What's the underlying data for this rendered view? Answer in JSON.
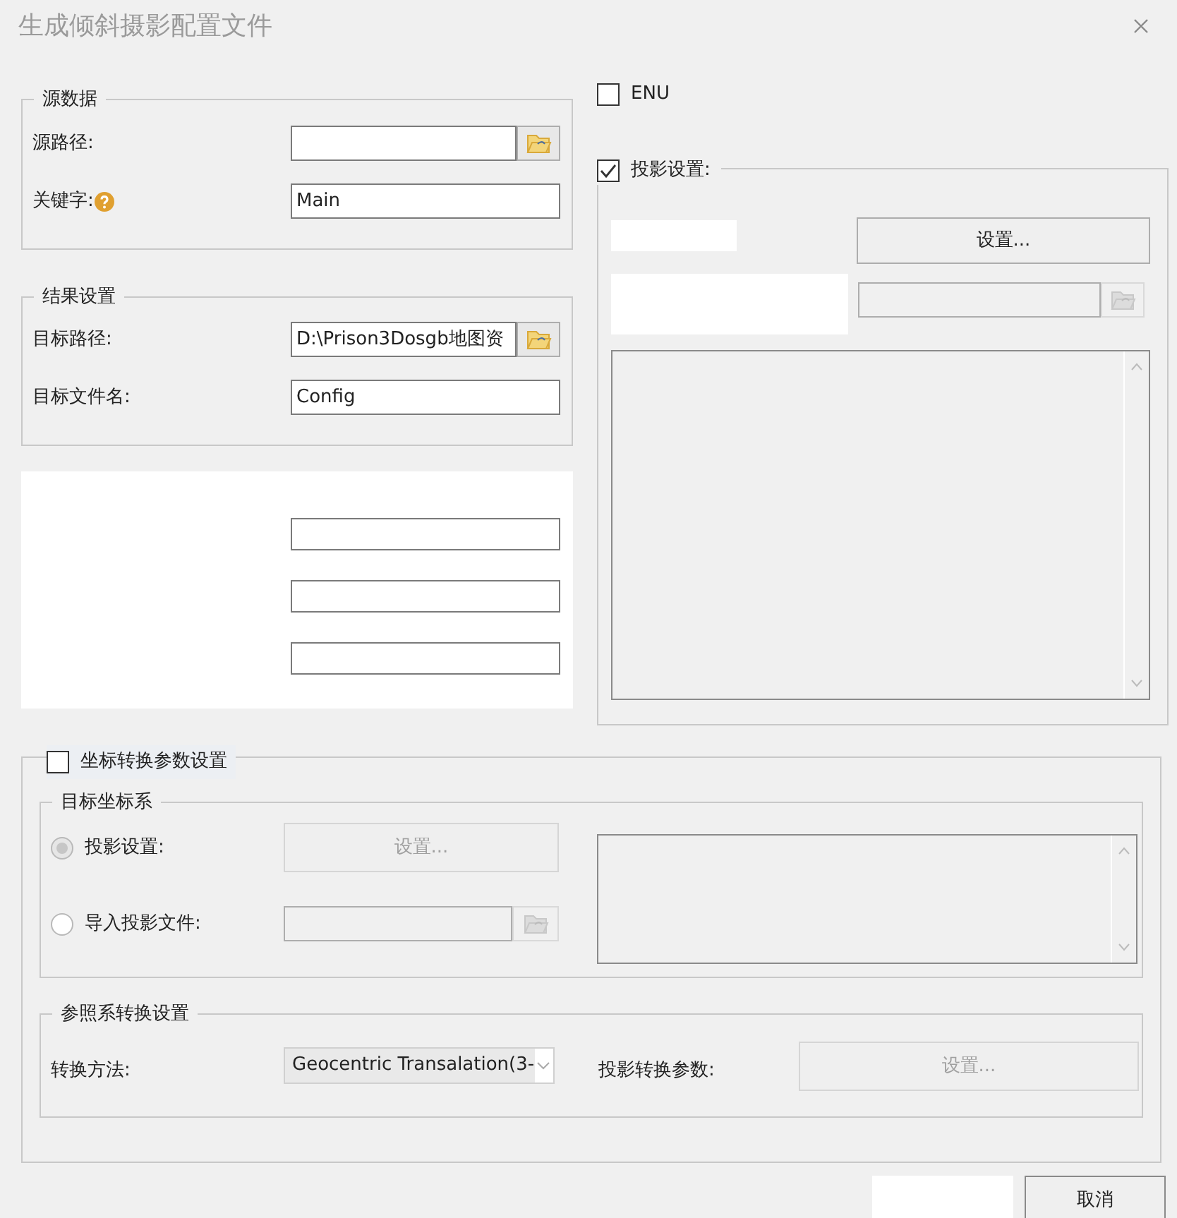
{
  "window": {
    "title": "生成倾斜摄影配置文件"
  },
  "source_data": {
    "title": "源数据",
    "fields": [
      {
        "label": "源路径:",
        "browse": true,
        "help": false
      },
      {
        "label": "关键字:",
        "value": "Main",
        "browse": false,
        "help": true
      }
    ]
  },
  "result_settings": {
    "title": "结果设置",
    "fields": [
      {
        "label": "目标路径:",
        "value": "D:\\Prison3Dosgb地图资",
        "browse": true,
        "help": false
      },
      {
        "label": "目标文件名:",
        "value": "Config",
        "browse": false,
        "help": false
      }
    ]
  },
  "masked_panel": {
    "fields": [
      {
        "kind": "text"
      },
      {
        "kind": "text"
      },
      {
        "kind": "text"
      }
    ]
  },
  "enu": {
    "label": "ENU",
    "checked": false
  },
  "projection": {
    "label": "投影设置:",
    "checked": true,
    "button": "设置...",
    "file_disabled": true
  },
  "coord_transform": {
    "label": "坐标转换参数设置",
    "checked": false,
    "target_crs": {
      "title": "目标坐标系",
      "options": [
        {
          "kind": "button",
          "label": "投影设置:",
          "selected": true,
          "disabled": true,
          "button": "设置..."
        },
        {
          "kind": "file",
          "label": "导入投影文件:",
          "selected": false,
          "disabled": false
        }
      ]
    },
    "reference_transform": {
      "title": "参照系转换设置",
      "method_label": "转换方法:",
      "method": "Geocentric Transalation(3-",
      "params_label": "投影转换参数:",
      "params_button": "设置...",
      "disabled": true
    }
  },
  "footer": {
    "cancel": "取消"
  }
}
